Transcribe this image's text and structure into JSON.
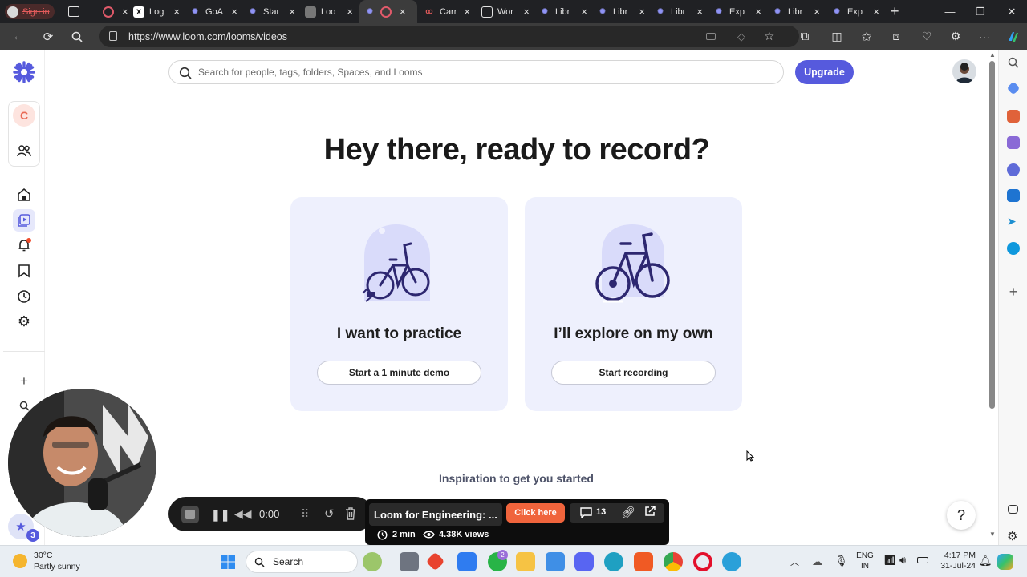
{
  "browser": {
    "profile_label": "Sign in",
    "tabs": [
      {
        "label": "",
        "icon": "recording-icon"
      },
      {
        "label": "Log",
        "icon": "x-logo-icon"
      },
      {
        "label": "GoA",
        "icon": "loom-icon"
      },
      {
        "label": "Star",
        "icon": "loom-icon"
      },
      {
        "label": "Loo",
        "icon": "loom-page-icon"
      },
      {
        "label": "",
        "icon": "loom-icon"
      },
      {
        "label": "Carr",
        "icon": "carrd-icon"
      },
      {
        "label": "Wor",
        "icon": "document-icon"
      },
      {
        "label": "Libr",
        "icon": "loom-icon"
      },
      {
        "label": "Libr",
        "icon": "loom-icon"
      },
      {
        "label": "Libr",
        "icon": "loom-icon"
      },
      {
        "label": "Exp",
        "icon": "loom-icon"
      },
      {
        "label": "Libr",
        "icon": "loom-icon"
      },
      {
        "label": "Exp",
        "icon": "loom-icon"
      }
    ],
    "url": "https://www.loom.com/looms/videos"
  },
  "loom": {
    "workspace_initial": "C",
    "search_placeholder": "Search for people, tags, folders, Spaces, and Looms",
    "upgrade_label": "Upgrade",
    "hero_title": "Hey there, ready to record?",
    "cards": [
      {
        "caption": "I want to practice",
        "button": "Start a 1 minute demo"
      },
      {
        "caption": "I’ll explore on my own",
        "button": "Start recording"
      }
    ],
    "inspiration_heading": "Inspiration to get you started",
    "help_label": "?",
    "accent_color": "#565ADD"
  },
  "recorder": {
    "timer": "0:00",
    "badge_count": "3"
  },
  "promo": {
    "title": "Loom for Engineering: ...",
    "cta": "Click here",
    "comments": "13",
    "duration": "2 min",
    "views": "4.38K views"
  },
  "taskbar": {
    "temperature": "30°C",
    "weather": "Partly sunny",
    "search_label": "Search",
    "whatsapp_badge": "2",
    "lang_top": "ENG",
    "lang_bottom": "IN",
    "time": "4:17 PM",
    "date": "31-Jul-24"
  }
}
